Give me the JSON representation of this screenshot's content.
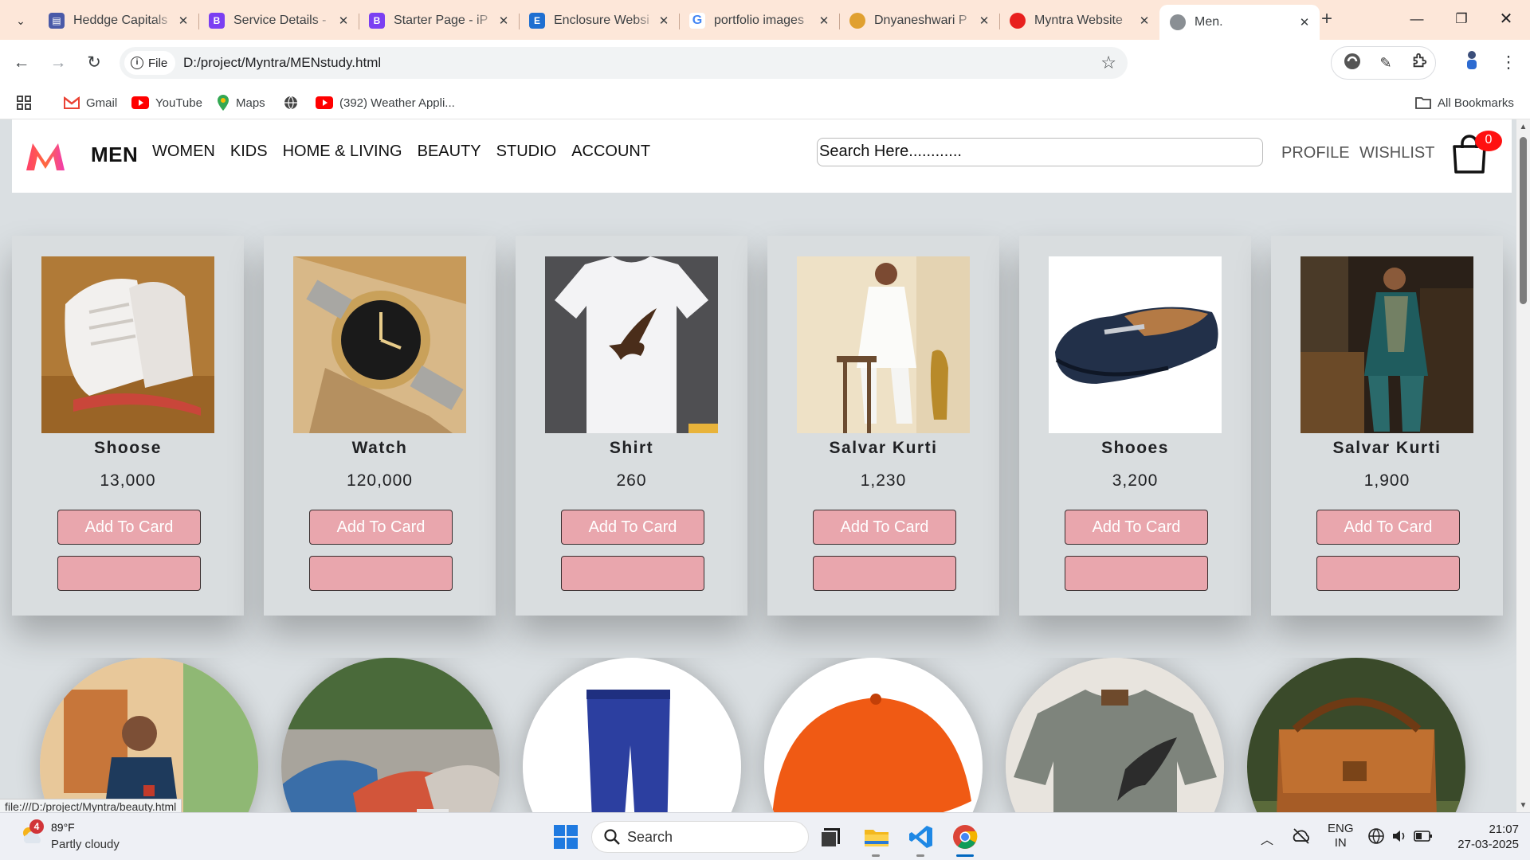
{
  "browser": {
    "tabs": [
      {
        "title": "Heddge Capitals",
        "favicon_color": "#4a5aa8",
        "active": false
      },
      {
        "title": "Service Details -",
        "favicon_color": "#7b3ff2",
        "active": false
      },
      {
        "title": "Starter Page - iP",
        "favicon_color": "#7b3ff2",
        "active": false
      },
      {
        "title": "Enclosure Websi",
        "favicon_color": "#1f6fd1",
        "active": false
      },
      {
        "title": "portfolio images",
        "favicon_color": "#4285f4",
        "active": false
      },
      {
        "title": "Dnyaneshwari P",
        "favicon_color": "#e0a030",
        "active": false
      },
      {
        "title": "Myntra Website",
        "favicon_color": "#e8201e",
        "active": false
      },
      {
        "title": "Men.",
        "favicon_color": "#5f6368",
        "active": true
      }
    ],
    "file_chip": "File",
    "url": "D:/project/Myntra/MENstudy.html",
    "bookmarks": [
      {
        "label": "Gmail",
        "icon": "gmail-icon"
      },
      {
        "label": "YouTube",
        "icon": "youtube-icon"
      },
      {
        "label": "Maps",
        "icon": "maps-icon"
      },
      {
        "label": "",
        "icon": "globe-icon"
      },
      {
        "label": "(392) Weather Appli...",
        "icon": "youtube-icon"
      }
    ],
    "all_bookmarks": "All Bookmarks",
    "status_url": "file:///D:/project/Myntra/beauty.html"
  },
  "site": {
    "brand": "MEN",
    "nav": [
      "WOMEN",
      "KIDS",
      "HOME & LIVING",
      "BEAUTY",
      "STUDIO",
      "ACCOUNT"
    ],
    "search_placeholder": "Search Here............",
    "profile": "PROFILE",
    "wishlist": "WISHLIST",
    "cart_count": "0",
    "accent_color": "#e9a6ad"
  },
  "products": [
    {
      "name": "Shoose",
      "price": "13,000",
      "button": "Add To Card",
      "image": "white-sneakers"
    },
    {
      "name": "Watch",
      "price": "120,000",
      "button": "Add To Card",
      "image": "gold-watch"
    },
    {
      "name": "Shirt",
      "price": "260",
      "button": "Add To Card",
      "image": "white-tshirt-eagle"
    },
    {
      "name": "Salvar Kurti",
      "price": "1,230",
      "button": "Add To Card",
      "image": "white-kurta"
    },
    {
      "name": "Shooes",
      "price": "3,200",
      "button": "Add To Card",
      "image": "navy-loafer"
    },
    {
      "name": "Salvar Kurti",
      "price": "1,900",
      "button": "Add To Card",
      "image": "teal-kurta"
    }
  ],
  "circle_items": [
    {
      "image": "man-ethnic-wear"
    },
    {
      "image": "blue-red-loafers"
    },
    {
      "image": "blue-trousers"
    },
    {
      "image": "orange-cap"
    },
    {
      "image": "grey-tshirt-bird"
    },
    {
      "image": "leather-bag"
    }
  ],
  "taskbar": {
    "weather_temp": "89°F",
    "weather_desc": "Partly cloudy",
    "weather_badge": "4",
    "search": "Search",
    "lang_1": "ENG",
    "lang_2": "IN",
    "time": "21:07",
    "date": "27-03-2025"
  }
}
